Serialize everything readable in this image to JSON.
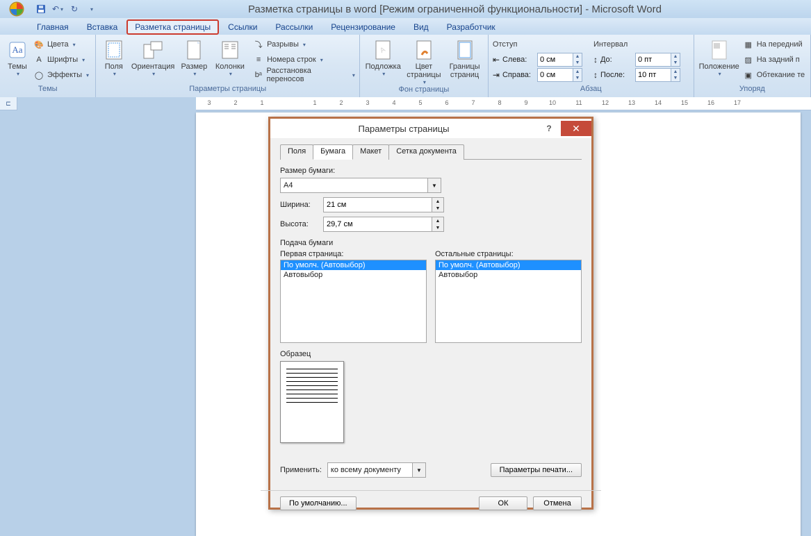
{
  "title": "Разметка страницы в word [Режим ограниченной функциональности] - Microsoft Word",
  "tabs": {
    "home": "Главная",
    "insert": "Вставка",
    "layout": "Разметка страницы",
    "links": "Ссылки",
    "mailings": "Рассылки",
    "review": "Рецензирование",
    "view": "Вид",
    "developer": "Разработчик"
  },
  "ribbon": {
    "themes": {
      "label": "Темы",
      "themesBtn": "Темы",
      "colors": "Цвета",
      "fonts": "Шрифты",
      "effects": "Эффекты"
    },
    "pagesetup": {
      "label": "Параметры страницы",
      "margins": "Поля",
      "orientation": "Ориентация",
      "size": "Размер",
      "columns": "Колонки",
      "breaks": "Разрывы",
      "lineNumbers": "Номера строк",
      "hyphenation": "Расстановка переносов"
    },
    "pagebg": {
      "label": "Фон страницы",
      "watermark": "Подложка",
      "color": "Цвет\nстраницы",
      "borders": "Границы\nстраниц"
    },
    "paragraph": {
      "label": "Абзац",
      "indentLabel": "Отступ",
      "left": "Слева:",
      "right": "Справа:",
      "leftVal": "0 см",
      "rightVal": "0 см",
      "spacingLabel": "Интервал",
      "before": "До:",
      "after": "После:",
      "beforeVal": "0 пт",
      "afterVal": "10 пт"
    },
    "arrange": {
      "label": "Упоряд",
      "position": "Положение",
      "front": "На передний",
      "back": "На задний п",
      "wrap": "Обтекание те"
    }
  },
  "ruler_labels": [
    "3",
    "2",
    "1",
    "",
    "1",
    "2",
    "3",
    "4",
    "5",
    "6",
    "7",
    "8",
    "9",
    "10",
    "11",
    "12",
    "13",
    "14",
    "15",
    "16",
    "17"
  ],
  "dialog": {
    "title": "Параметры страницы",
    "tabs": {
      "fields": "Поля",
      "paper": "Бумага",
      "layout": "Макет",
      "grid": "Сетка документа"
    },
    "sizeLabel": "Размер бумаги:",
    "sizeValue": "A4",
    "widthLabel": "Ширина:",
    "widthValue": "21 см",
    "heightLabel": "Высота:",
    "heightValue": "29,7 см",
    "feedLabel": "Подача бумаги",
    "firstPage": "Первая страница:",
    "otherPages": "Остальные страницы:",
    "opt1": "По умолч. (Автовыбор)",
    "opt2": "Автовыбор",
    "sampleLabel": "Образец",
    "applyLabel": "Применить:",
    "applyValue": "ко всему документу",
    "printOptions": "Параметры печати...",
    "default": "По умолчанию...",
    "ok": "ОК",
    "cancel": "Отмена"
  }
}
